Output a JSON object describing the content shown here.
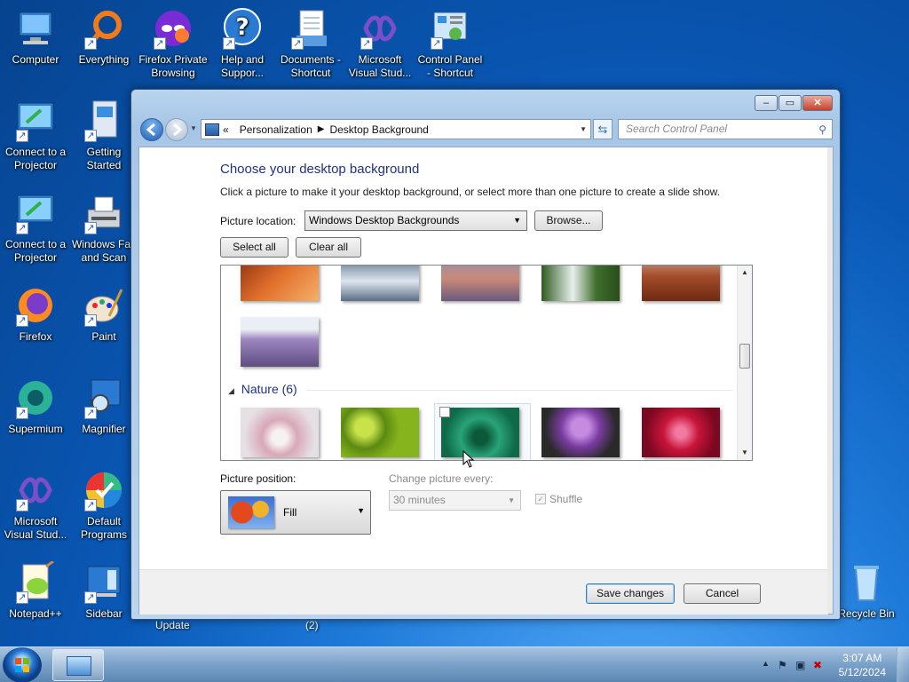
{
  "desktop": {
    "icons": [
      {
        "label": "Computer"
      },
      {
        "label": "Everything"
      },
      {
        "label": "Firefox Private Browsing"
      },
      {
        "label": "Help and Suppor..."
      },
      {
        "label": "Documents - Shortcut"
      },
      {
        "label": "Microsoft Visual Stud..."
      },
      {
        "label": "Control Panel - Shortcut"
      },
      {
        "label": "Connect to a Projector"
      },
      {
        "label": "Getting Started"
      },
      {
        "label": "Connect to a Projector"
      },
      {
        "label": "Windows Fax and Scan"
      },
      {
        "label": "Firefox"
      },
      {
        "label": "Paint"
      },
      {
        "label": "Supermium"
      },
      {
        "label": "Magnifier"
      },
      {
        "label": "Microsoft Visual Stud..."
      },
      {
        "label": "Default Programs"
      },
      {
        "label": "Notepad++"
      },
      {
        "label": "Sidebar"
      },
      {
        "label": "Recycle Bin"
      }
    ],
    "partial_labels": [
      "Update",
      "(2)"
    ]
  },
  "window": {
    "caption_buttons": {
      "minimize": "–",
      "maximize": "▭",
      "close": "✕"
    },
    "breadcrumb": [
      "Personalization",
      "Desktop Background"
    ],
    "breadcrumb_prefix": "«",
    "search_placeholder": "Search Control Panel",
    "title": "Choose your desktop background",
    "subtitle": "Click a picture to make it your desktop background, or select more than one picture to create a slide show.",
    "picture_location_label": "Picture location:",
    "picture_location_value": "Windows Desktop Backgrounds",
    "browse_label": "Browse...",
    "select_all_label": "Select all",
    "clear_all_label": "Clear all",
    "group": {
      "name": "Nature (6)"
    },
    "picture_position_label": "Picture position:",
    "picture_position_value": "Fill",
    "change_picture_label": "Change picture every:",
    "change_picture_value": "30 minutes",
    "shuffle_label": "Shuffle",
    "save_label": "Save changes",
    "cancel_label": "Cancel"
  },
  "taskbar": {
    "time": "3:07 AM",
    "date": "5/12/2024"
  },
  "colors": {
    "title_blue": "#1e3287",
    "window_frame": "#a7c6e6",
    "desktop_blue": "#0a58b6"
  }
}
